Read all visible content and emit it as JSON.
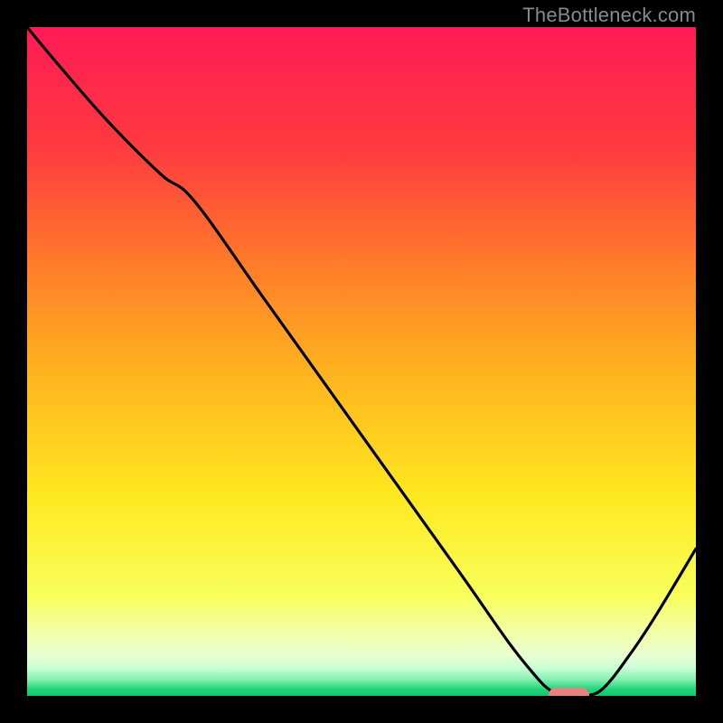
{
  "watermark": "TheBottleneck.com",
  "chart_data": {
    "type": "line",
    "title": "",
    "xlabel": "",
    "ylabel": "",
    "xlim": [
      0,
      100
    ],
    "ylim": [
      0,
      100
    ],
    "grid": false,
    "legend": false,
    "gradient_stops": [
      {
        "pos": 0.0,
        "color": "#ff1a55"
      },
      {
        "pos": 0.18,
        "color": "#ff3a3f"
      },
      {
        "pos": 0.35,
        "color": "#ff7a2a"
      },
      {
        "pos": 0.52,
        "color": "#ffb41f"
      },
      {
        "pos": 0.7,
        "color": "#ffe81f"
      },
      {
        "pos": 0.85,
        "color": "#f8ff5a"
      },
      {
        "pos": 0.9,
        "color": "#f3ffa0"
      },
      {
        "pos": 0.938,
        "color": "#eaffd0"
      },
      {
        "pos": 0.958,
        "color": "#c9ffd6"
      },
      {
        "pos": 0.975,
        "color": "#88f0b2"
      },
      {
        "pos": 0.99,
        "color": "#1fd57a"
      },
      {
        "pos": 1.0,
        "color": "#13c56e"
      }
    ],
    "series": [
      {
        "name": "bottleneck-curve",
        "x": [
          0,
          5,
          12,
          20,
          25,
          35,
          45,
          55,
          65,
          72,
          76,
          78,
          80,
          83,
          86,
          90,
          94,
          100
        ],
        "y": [
          100,
          94,
          86,
          78,
          74,
          60,
          46,
          32,
          18,
          8,
          3,
          1,
          0,
          0,
          1,
          6,
          12,
          22
        ]
      }
    ],
    "marker": {
      "x_start": 78,
      "x_end": 84,
      "y": 0,
      "color": "#e7817f"
    }
  }
}
